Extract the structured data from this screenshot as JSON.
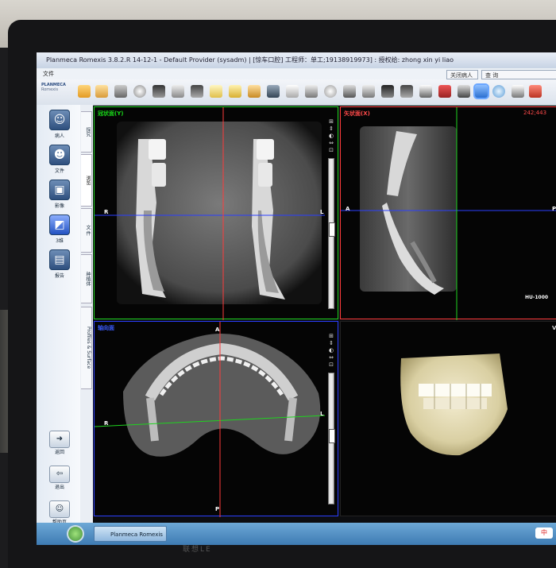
{
  "window": {
    "title": "Planmeca Romexis 3.8.2.R  14-12-1 - Default Provider (sysadm) | [惊车口腔] 工程师：单工;19138919973] : 授权给: zhong xin yi liao"
  },
  "menubar": {
    "file": "文件",
    "box_1": "关闭病人",
    "box_2": "查 询"
  },
  "logo": {
    "line1": "PLANMECA",
    "line2": "Romexis"
  },
  "left_nav": [
    {
      "label": "病人",
      "icon": "patients-icon"
    },
    {
      "label": "文件",
      "icon": "file-icon"
    },
    {
      "label": "影像",
      "icon": "image-icon"
    },
    {
      "label": "3维",
      "icon": "3d-icon"
    },
    {
      "label": "报告",
      "icon": "report-icon"
    }
  ],
  "bottom_nav": [
    {
      "label": "返回",
      "icon": "back-icon"
    },
    {
      "label": "退出",
      "icon": "exit-icon"
    },
    {
      "label": "帮助页",
      "icon": "help-icon"
    }
  ],
  "vertical_tabs": [
    {
      "label": "探究",
      "active": false
    },
    {
      "label": "浏览",
      "active": true
    },
    {
      "label": "文 件",
      "active": false
    },
    {
      "label": "种植体",
      "active": false
    },
    {
      "label": "Profiles & Surface",
      "active": false
    }
  ],
  "views": {
    "coronal": {
      "label": "冠状面(Y)",
      "label_color": "#19d719",
      "left": "R",
      "right": "L"
    },
    "sagittal": {
      "label": "矢状面(X)",
      "label_color": "#ff4a4a",
      "right_top": "242;443",
      "left": "A",
      "right": "P",
      "badge": "HU-1000"
    },
    "axial": {
      "label": "轴向面",
      "label_color": "#3b5bff",
      "top": "A",
      "bottom": "P",
      "left": "R",
      "right": "L"
    },
    "render3d": {
      "top_right": "V"
    }
  },
  "taskbar": {
    "task_label": "Planmeca Romexis",
    "tray_text": "中"
  },
  "monitor": {
    "brand": "联想LE"
  }
}
